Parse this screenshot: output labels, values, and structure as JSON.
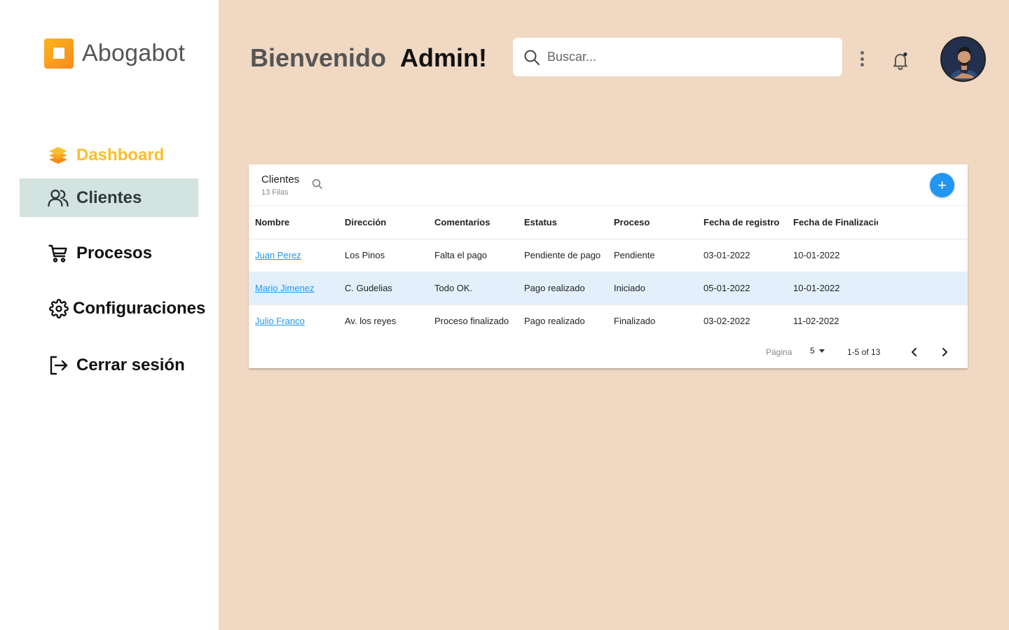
{
  "brand": {
    "name": "Abogabot",
    "logo_icon": "app-logo-icon"
  },
  "sidebar": {
    "items": [
      {
        "label": "Dashboard",
        "icon": "layers-icon",
        "color": "#fbbf2a"
      },
      {
        "label": "Clientes",
        "icon": "users-icon",
        "active": true
      },
      {
        "label": "Procesos",
        "icon": "cart-icon"
      },
      {
        "label": "Configuraciones",
        "icon": "gear-icon"
      },
      {
        "label": "Cerrar sesión",
        "icon": "logout-icon"
      }
    ]
  },
  "header": {
    "welcome": "Bienvenido",
    "user": "Admin!",
    "search_placeholder": "Buscar...",
    "search_value": ""
  },
  "table": {
    "title": "Clientes",
    "subtitle": "13 Filas",
    "columns": [
      "Nombre",
      "Dirección",
      "Comentarios",
      "Estatus",
      "Proceso",
      "Fecha de registro",
      "Fecha de Finalizacióı"
    ],
    "rows": [
      [
        "Juan Perez",
        "Los Pinos",
        "Falta el pago",
        "Pendiente de pago",
        "Pendiente",
        "03-01-2022",
        "10-01-2022"
      ],
      [
        "Mario Jimenez",
        "C. Gudelias",
        "Todo OK.",
        "Pago realizado",
        "Iniciado",
        "05-01-2022",
        "10-01-2022"
      ],
      [
        "Julio Franco",
        "Av. los reyes",
        "Proceso finalizado",
        "Pago realizado",
        "Finalizado",
        "03-02-2022",
        "11-02-2022"
      ]
    ],
    "selected_row": 1,
    "add_label": "+"
  },
  "pagination": {
    "label": "Página",
    "page_size": "5",
    "range": "1-5 of 13"
  },
  "colors": {
    "background": "#f0d8c2",
    "accent": "#2196f3",
    "dashboard": "#fbbf2a",
    "active_nav": "#d3e3df"
  }
}
